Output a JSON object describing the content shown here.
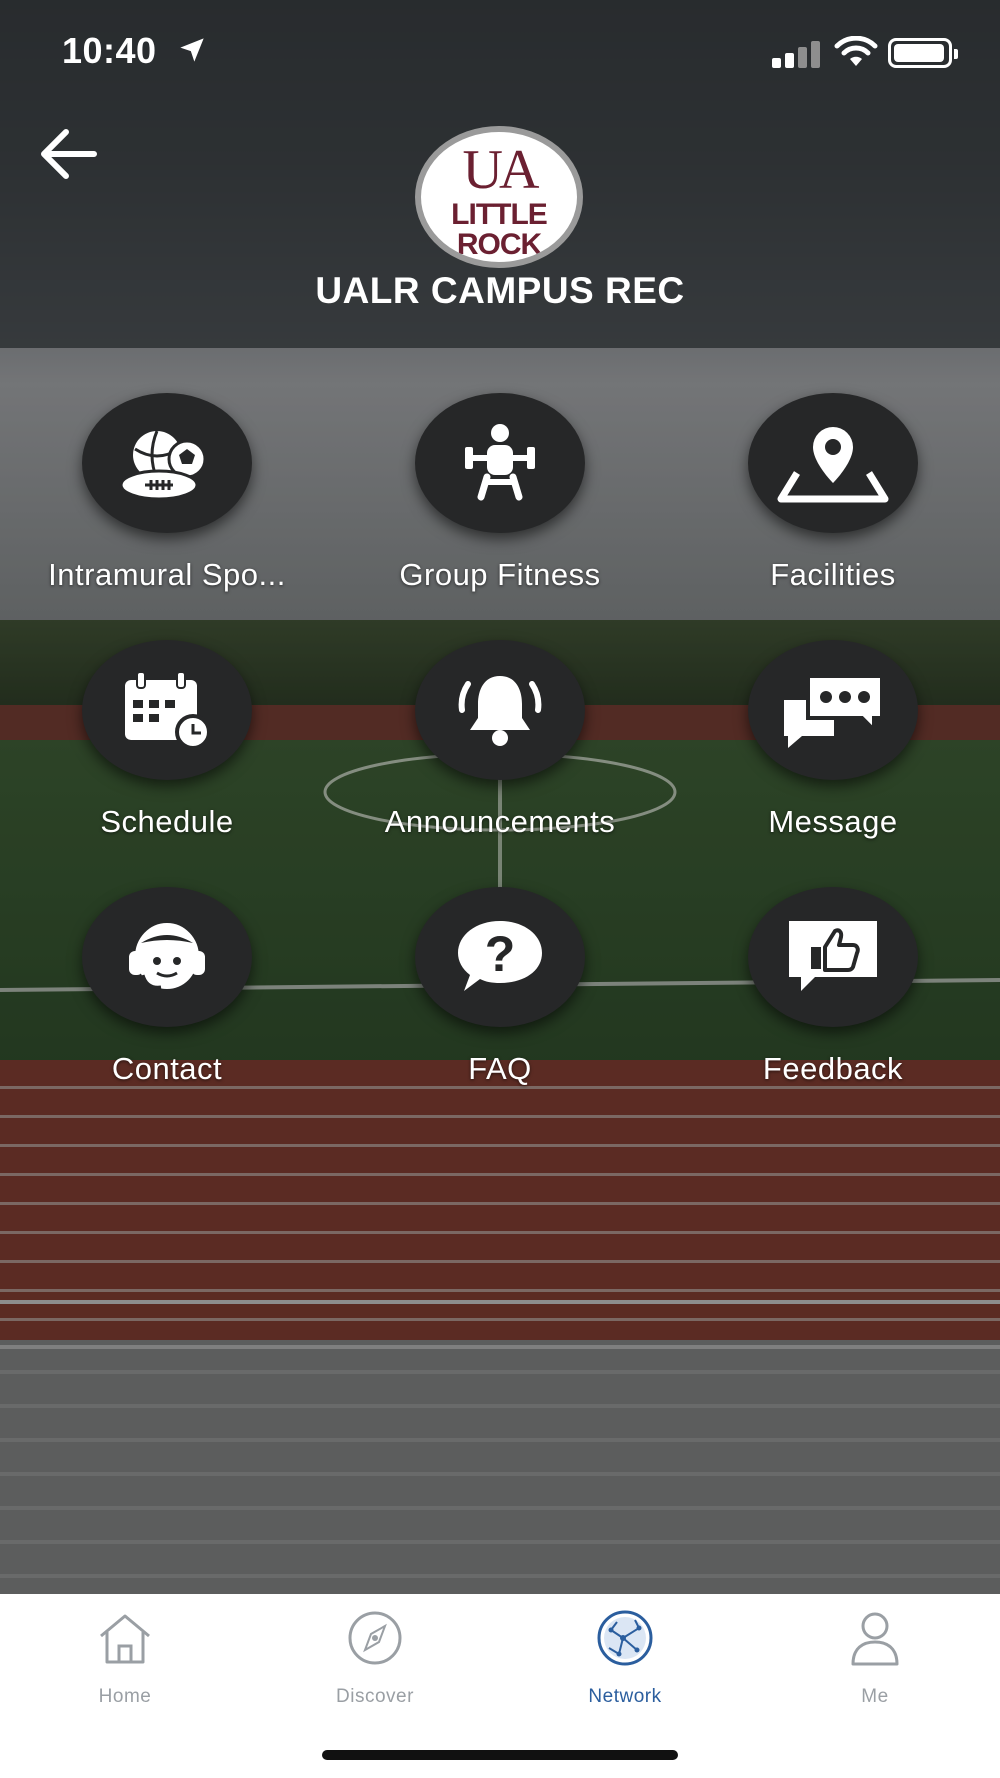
{
  "status_bar": {
    "time": "10:40"
  },
  "header": {
    "title": "UALR CAMPUS REC",
    "logo_text": [
      "UA",
      "LITTLE",
      "ROCK"
    ]
  },
  "tiles": [
    {
      "label": "Intramural Spo...",
      "icon": "sports-balls-icon"
    },
    {
      "label": "Group Fitness",
      "icon": "weightlifter-icon"
    },
    {
      "label": "Facilities",
      "icon": "map-pin-icon"
    },
    {
      "label": "Schedule",
      "icon": "calendar-clock-icon"
    },
    {
      "label": "Announcements",
      "icon": "bell-icon"
    },
    {
      "label": "Message",
      "icon": "chat-bubbles-icon"
    },
    {
      "label": "Contact",
      "icon": "headset-person-icon"
    },
    {
      "label": "FAQ",
      "icon": "question-bubble-icon"
    },
    {
      "label": "Feedback",
      "icon": "thumbs-up-bubble-icon"
    }
  ],
  "tabbar": {
    "items": [
      {
        "label": "Home",
        "icon": "home-icon",
        "active": false
      },
      {
        "label": "Discover",
        "icon": "compass-icon",
        "active": false
      },
      {
        "label": "Network",
        "icon": "network-icon",
        "active": true
      },
      {
        "label": "Me",
        "icon": "person-icon",
        "active": false
      }
    ],
    "active_color": "#2b5e9e",
    "inactive_color": "#9a9fa4"
  },
  "colors": {
    "tile_circle": "#262728",
    "logo_maroon": "#6b2031"
  }
}
